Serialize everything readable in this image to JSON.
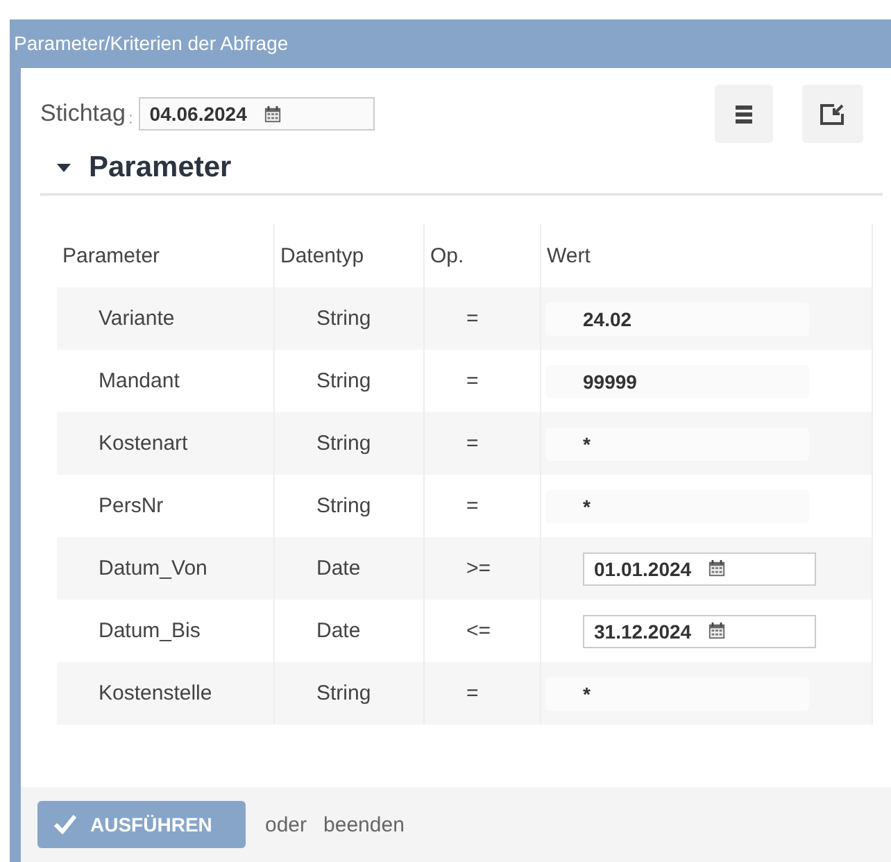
{
  "window": {
    "title": "Parameter/Kriterien der Abfrage"
  },
  "stichtag": {
    "label": "Stichtag",
    "separator": ":",
    "value": "04.06.2024"
  },
  "section": {
    "title": "Parameter",
    "expanded": true
  },
  "table": {
    "columns": [
      "Parameter",
      "Datentyp",
      "Op.",
      "Wert"
    ],
    "rows": [
      {
        "kind": "text",
        "name": "Variante",
        "type": "String",
        "op": "=",
        "value": "24.02"
      },
      {
        "kind": "text",
        "name": "Mandant",
        "type": "String",
        "op": "=",
        "value": "99999"
      },
      {
        "kind": "text",
        "name": "Kostenart",
        "type": "String",
        "op": "=",
        "value": "*"
      },
      {
        "kind": "text",
        "name": "PersNr",
        "type": "String",
        "op": "=",
        "value": "*"
      },
      {
        "kind": "date",
        "name": "Datum_Von",
        "type": "Date",
        "op": ">=",
        "value": "01.01.2024"
      },
      {
        "kind": "date",
        "name": "Datum_Bis",
        "type": "Date",
        "op": "<=",
        "value": "31.12.2024"
      },
      {
        "kind": "text",
        "name": "Kostenstelle",
        "type": "String",
        "op": "=",
        "value": "*"
      }
    ]
  },
  "footer": {
    "run_button": "AUSFÜHREN",
    "or": "oder",
    "end_link": "beenden"
  }
}
